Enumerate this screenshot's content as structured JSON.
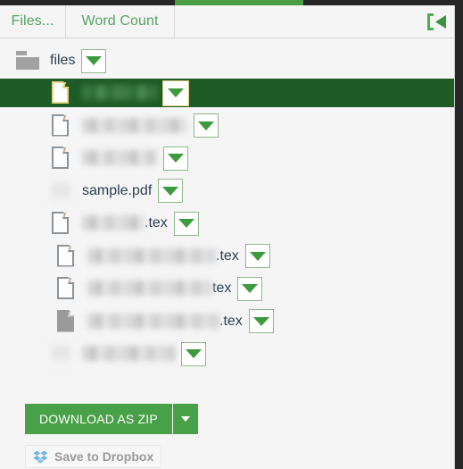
{
  "window": {
    "accent_green": "#4a9e42",
    "selection_green": "#1e5b26",
    "button_green": "#48a148",
    "text_navy": "#2b3e50"
  },
  "toolbar": {
    "files_label": "Files...",
    "word_count_label": "Word Count",
    "collapse_icon": "collapse-panel-icon"
  },
  "tree": {
    "folder": {
      "name": "files",
      "icon": "folder-icon",
      "caret": "chevron-down-icon"
    },
    "rows": [
      {
        "name": "",
        "redacted": true,
        "redact_width": 84,
        "indent": 56,
        "icon": "document-icon",
        "selected": true,
        "caret": "chevron-down-icon"
      },
      {
        "name": "",
        "redacted": true,
        "redact_width": 118,
        "indent": 56,
        "icon": "document-icon",
        "selected": false,
        "caret": "chevron-down-icon"
      },
      {
        "name": "",
        "redacted": true,
        "redact_width": 84,
        "indent": 56,
        "icon": "document-icon",
        "selected": false,
        "caret": "chevron-down-icon"
      },
      {
        "name": "sample.pdf",
        "redacted": false,
        "redact_width": 0,
        "indent": 56,
        "icon": "blurred-icon",
        "selected": false,
        "caret": "chevron-down-icon"
      },
      {
        "name": ".tex",
        "redacted": true,
        "redact_width": 70,
        "indent": 56,
        "icon": "document-icon",
        "selected": false,
        "caret": "chevron-down-icon"
      },
      {
        "name": ".tex",
        "redacted": true,
        "redact_width": 144,
        "indent": 62,
        "icon": "document-icon",
        "selected": false,
        "caret": "chevron-down-icon"
      },
      {
        "name": "tex",
        "redacted": true,
        "redact_width": 140,
        "indent": 62,
        "icon": "document-icon",
        "selected": false,
        "caret": "chevron-down-icon"
      },
      {
        "name": ".tex",
        "redacted": true,
        "redact_width": 148,
        "indent": 62,
        "icon": "document-icon-filled",
        "selected": false,
        "caret": "chevron-down-icon"
      },
      {
        "name": "",
        "redacted": true,
        "redact_width": 104,
        "indent": 56,
        "icon": "blurred-icon",
        "selected": false,
        "caret": "chevron-down-icon"
      }
    ]
  },
  "actions": {
    "download_label": "DOWNLOAD AS ZIP",
    "download_caret": "chevron-down-icon",
    "dropbox_label": "Save to Dropbox",
    "dropbox_icon": "dropbox-icon"
  }
}
